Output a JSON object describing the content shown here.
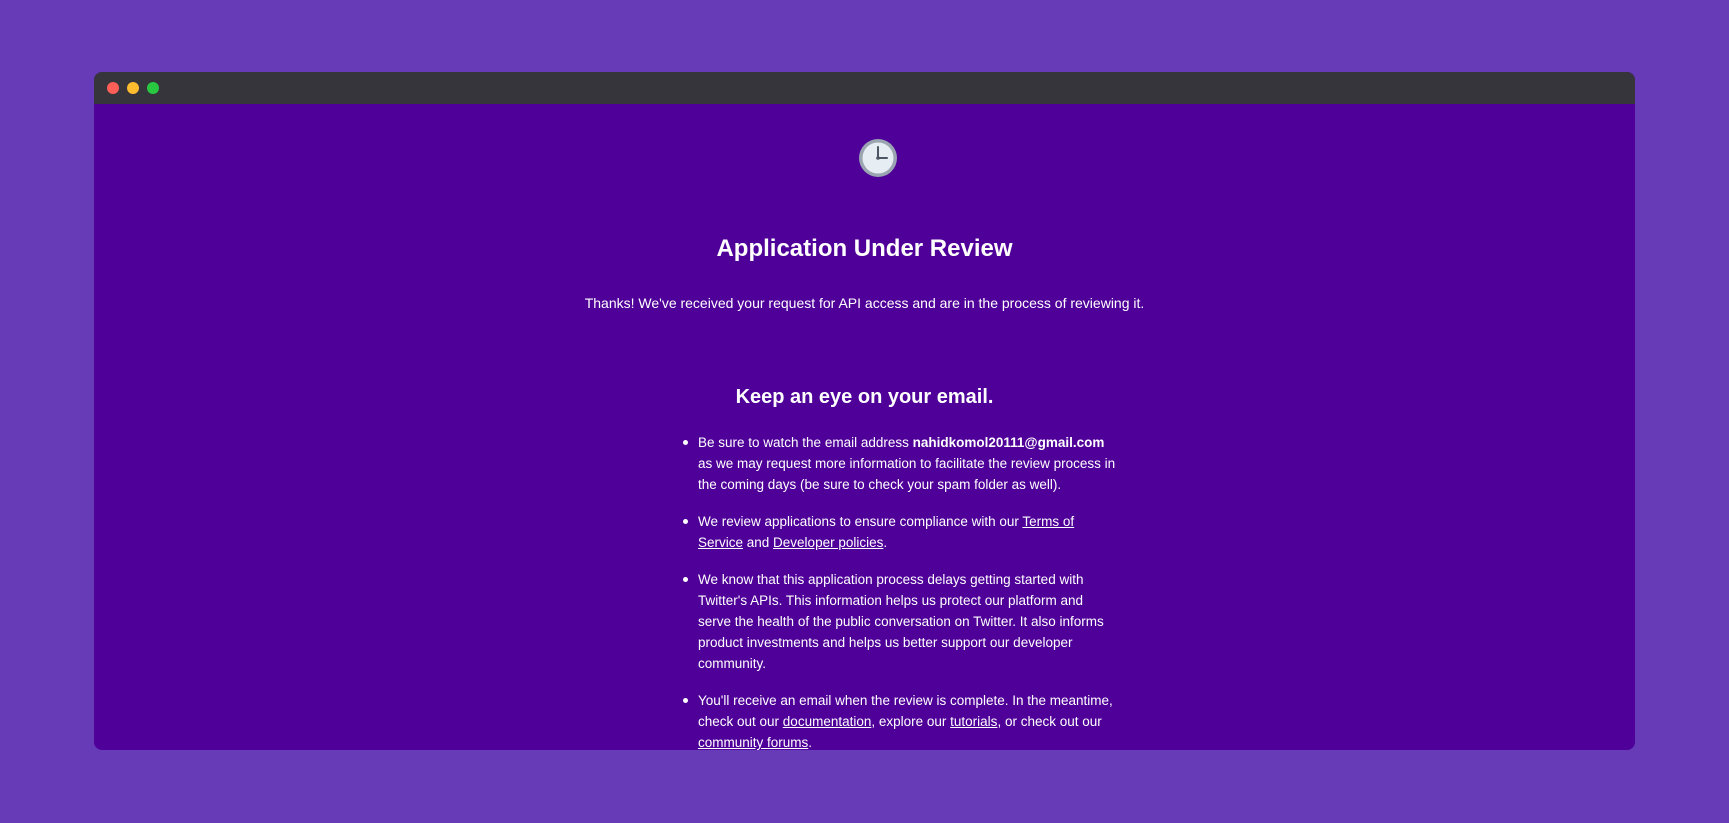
{
  "window": {
    "controls": [
      "close",
      "minimize",
      "maximize"
    ]
  },
  "icon": "clock-icon",
  "title": "Application Under Review",
  "subtitle": "Thanks! We've received your request for API access and are in the process of reviewing it.",
  "email_section": {
    "heading": "Keep an eye on your email.",
    "item1": {
      "prefix": "Be sure to watch the email address ",
      "email": "nahidkomol20111@gmail.com",
      "suffix": " as we may request more information to facilitate the review process in the coming days (be sure to check your spam folder as well)."
    },
    "item2": {
      "prefix": "We review applications to ensure compliance with our ",
      "tos_link": "Terms of Service",
      "middle": " and ",
      "policies_link": "Developer policies",
      "suffix": "."
    },
    "item3": {
      "text": "We know that this application process delays getting started with Twitter's APIs. This information helps us protect our platform and serve the health of the public conversation on Twitter. It also informs product investments and helps us better support our developer community."
    },
    "item4": {
      "prefix": "You'll receive an email when the review is complete. In the meantime, check out our ",
      "documentation_link": "documentation",
      "middle1": ", explore our ",
      "tutorials_link": "tutorials",
      "middle2": ", or check out our ",
      "forums_link": "community forums",
      "suffix": "."
    }
  },
  "colors": {
    "page_background": "#673ab7",
    "window_background": "#4f0099",
    "titlebar": "#37353c",
    "close": "#ff5f57",
    "minimize": "#febc2e",
    "maximize": "#28c840"
  }
}
